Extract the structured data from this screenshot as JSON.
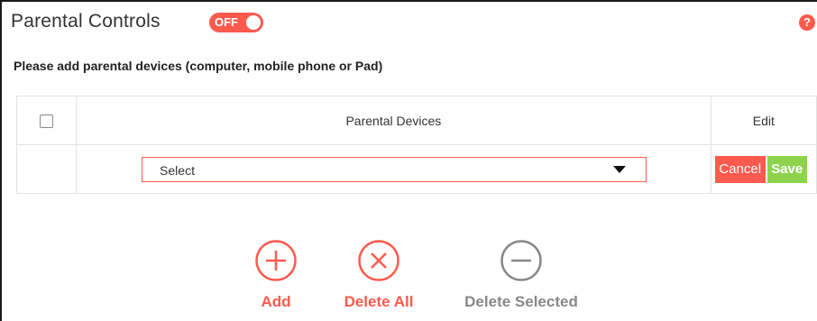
{
  "header": {
    "title": "Parental Controls",
    "toggle_label": "OFF",
    "help_icon": "question-circle-icon"
  },
  "instruction": "Please add parental devices (computer, mobile phone or Pad)",
  "table": {
    "columns": [
      "Parental Devices",
      "Edit"
    ],
    "row": {
      "select_value": "Select",
      "cancel_label": "Cancel",
      "save_label": "Save"
    }
  },
  "actions": [
    {
      "label": "Add",
      "icon": "plus-circle-icon"
    },
    {
      "label": "Delete All",
      "icon": "x-circle-icon"
    },
    {
      "label": "Delete Selected",
      "icon": "minus-circle-icon"
    }
  ],
  "colors": {
    "accent": "#ff5a4e",
    "save": "#8dd34b",
    "disabled": "#888888"
  }
}
